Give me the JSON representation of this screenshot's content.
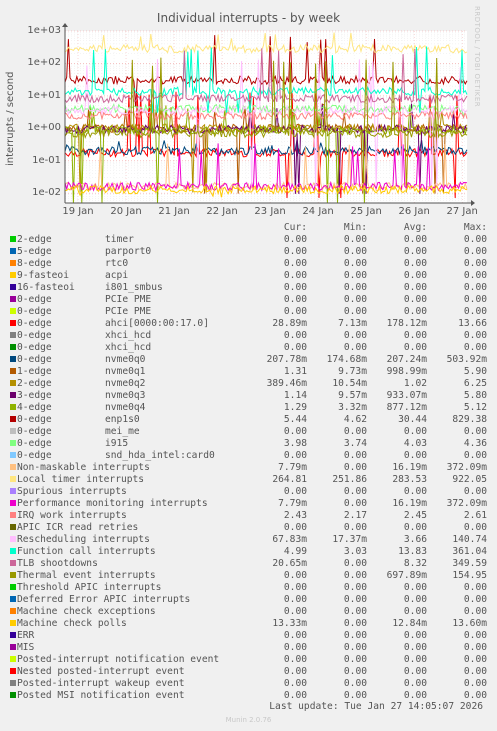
{
  "chart_data": {
    "type": "line",
    "title": "Individual interrupts - by week",
    "ylabel": "interrupts / second",
    "yscale": "log",
    "ylim": [
      0.005,
      1000
    ],
    "yticks": [
      {
        "label": "1e-02",
        "value": 0.01
      },
      {
        "label": "1e-01",
        "value": 0.1
      },
      {
        "label": "1e+00",
        "value": 1
      },
      {
        "label": "1e+01",
        "value": 10
      },
      {
        "label": "1e+02",
        "value": 100
      },
      {
        "label": "1e+03",
        "value": 1000
      }
    ],
    "xticks": [
      "19 Jan",
      "20 Jan",
      "21 Jan",
      "22 Jan",
      "23 Jan",
      "24 Jan",
      "25 Jan",
      "26 Jan",
      "27 Jan"
    ],
    "grid": true,
    "watermark": "RRDTOOL / TOBI OETIKER",
    "columns": [
      "",
      "",
      "Cur:",
      "Min:",
      "Avg:",
      "Max:"
    ],
    "series": [
      {
        "label": "2-edge",
        "desc": "timer",
        "color": "#00cc00",
        "cur": "0.00",
        "min": "0.00",
        "avg": "0.00",
        "max": "0.00"
      },
      {
        "label": "5-edge",
        "desc": "parport0",
        "color": "#0066b3",
        "cur": "0.00",
        "min": "0.00",
        "avg": "0.00",
        "max": "0.00"
      },
      {
        "label": "8-edge",
        "desc": "rtc0",
        "color": "#ff8000",
        "cur": "0.00",
        "min": "0.00",
        "avg": "0.00",
        "max": "0.00"
      },
      {
        "label": "9-fasteoi",
        "desc": "acpi",
        "color": "#ffcc00",
        "cur": "0.00",
        "min": "0.00",
        "avg": "0.00",
        "max": "0.00"
      },
      {
        "label": "16-fasteoi",
        "desc": "i801_smbus",
        "color": "#330099",
        "cur": "0.00",
        "min": "0.00",
        "avg": "0.00",
        "max": "0.00"
      },
      {
        "label": "0-edge",
        "desc": "PCIe PME",
        "color": "#990099",
        "cur": "0.00",
        "min": "0.00",
        "avg": "0.00",
        "max": "0.00"
      },
      {
        "label": "0-edge",
        "desc": "PCIe PME",
        "color": "#ccff00",
        "cur": "0.00",
        "min": "0.00",
        "avg": "0.00",
        "max": "0.00"
      },
      {
        "label": "0-edge",
        "desc": "ahci[0000:00:17.0]",
        "color": "#ff0000",
        "cur": "28.89m",
        "min": "7.13m",
        "avg": "178.12m",
        "max": "13.66"
      },
      {
        "label": "0-edge",
        "desc": "xhci_hcd",
        "color": "#808080",
        "cur": "0.00",
        "min": "0.00",
        "avg": "0.00",
        "max": "0.00"
      },
      {
        "label": "0-edge",
        "desc": "xhci_hcd",
        "color": "#008f00",
        "cur": "0.00",
        "min": "0.00",
        "avg": "0.00",
        "max": "0.00"
      },
      {
        "label": "0-edge",
        "desc": "nvme0q0",
        "color": "#00487d",
        "cur": "207.78m",
        "min": "174.68m",
        "avg": "207.24m",
        "max": "503.92m"
      },
      {
        "label": "1-edge",
        "desc": "nvme0q1",
        "color": "#b35a00",
        "cur": "1.31",
        "min": "9.73m",
        "avg": "998.99m",
        "max": "5.90"
      },
      {
        "label": "2-edge",
        "desc": "nvme0q2",
        "color": "#b38f00",
        "cur": "389.46m",
        "min": "10.54m",
        "avg": "1.02",
        "max": "6.25"
      },
      {
        "label": "3-edge",
        "desc": "nvme0q3",
        "color": "#6b006b",
        "cur": "1.14",
        "min": "9.57m",
        "avg": "933.07m",
        "max": "5.80"
      },
      {
        "label": "4-edge",
        "desc": "nvme0q4",
        "color": "#8fb300",
        "cur": "1.29",
        "min": "3.32m",
        "avg": "877.12m",
        "max": "5.12"
      },
      {
        "label": "0-edge",
        "desc": "enp1s0",
        "color": "#b30000",
        "cur": "5.44",
        "min": "4.62",
        "avg": "30.44",
        "max": "829.38"
      },
      {
        "label": "0-edge",
        "desc": "mei_me",
        "color": "#bebebe",
        "cur": "0.00",
        "min": "0.00",
        "avg": "0.00",
        "max": "0.00"
      },
      {
        "label": "0-edge",
        "desc": "i915",
        "color": "#80ff80",
        "cur": "3.98",
        "min": "3.74",
        "avg": "4.03",
        "max": "4.36"
      },
      {
        "label": "0-edge",
        "desc": "snd_hda_intel:card0",
        "color": "#80c9ff",
        "cur": "0.00",
        "min": "0.00",
        "avg": "0.00",
        "max": "0.00"
      },
      {
        "label": "Non-maskable interrupts",
        "desc": "",
        "color": "#ffc080",
        "cur": "7.79m",
        "min": "0.00",
        "avg": "16.19m",
        "max": "372.09m"
      },
      {
        "label": "Local timer interrupts",
        "desc": "",
        "color": "#ffe680",
        "cur": "264.81",
        "min": "251.86",
        "avg": "283.53",
        "max": "922.05"
      },
      {
        "label": "Spurious interrupts",
        "desc": "",
        "color": "#aa80ff",
        "cur": "0.00",
        "min": "0.00",
        "avg": "0.00",
        "max": "0.00"
      },
      {
        "label": "Performance monitoring interrupts",
        "desc": "",
        "color": "#ee00cc",
        "cur": "7.79m",
        "min": "0.00",
        "avg": "16.19m",
        "max": "372.09m"
      },
      {
        "label": "IRQ work interrupts",
        "desc": "",
        "color": "#ff8080",
        "cur": "2.43",
        "min": "2.17",
        "avg": "2.45",
        "max": "2.61"
      },
      {
        "label": "APIC ICR read retries",
        "desc": "",
        "color": "#666600",
        "cur": "0.00",
        "min": "0.00",
        "avg": "0.00",
        "max": "0.00"
      },
      {
        "label": "Rescheduling interrupts",
        "desc": "",
        "color": "#ffbfff",
        "cur": "67.83m",
        "min": "17.37m",
        "avg": "3.66",
        "max": "140.74"
      },
      {
        "label": "Function call interrupts",
        "desc": "",
        "color": "#00ffcc",
        "cur": "4.99",
        "min": "3.03",
        "avg": "13.83",
        "max": "361.04"
      },
      {
        "label": "TLB shootdowns",
        "desc": "",
        "color": "#cc6699",
        "cur": "20.65m",
        "min": "0.00",
        "avg": "8.32",
        "max": "349.59"
      },
      {
        "label": "Thermal event interrupts",
        "desc": "",
        "color": "#999900",
        "cur": "0.00",
        "min": "0.00",
        "avg": "697.89m",
        "max": "154.95"
      },
      {
        "label": "Threshold APIC interrupts",
        "desc": "",
        "color": "#00cc00",
        "cur": "0.00",
        "min": "0.00",
        "avg": "0.00",
        "max": "0.00"
      },
      {
        "label": "Deferred Error APIC interrupts",
        "desc": "",
        "color": "#0066b3",
        "cur": "0.00",
        "min": "0.00",
        "avg": "0.00",
        "max": "0.00"
      },
      {
        "label": "Machine check exceptions",
        "desc": "",
        "color": "#ff8000",
        "cur": "0.00",
        "min": "0.00",
        "avg": "0.00",
        "max": "0.00"
      },
      {
        "label": "Machine check polls",
        "desc": "",
        "color": "#ffcc00",
        "cur": "13.33m",
        "min": "0.00",
        "avg": "12.84m",
        "max": "13.60m"
      },
      {
        "label": "ERR",
        "desc": "",
        "color": "#330099",
        "cur": "0.00",
        "min": "0.00",
        "avg": "0.00",
        "max": "0.00"
      },
      {
        "label": "MIS",
        "desc": "",
        "color": "#990099",
        "cur": "0.00",
        "min": "0.00",
        "avg": "0.00",
        "max": "0.00"
      },
      {
        "label": "Posted-interrupt notification event",
        "desc": "",
        "color": "#ccff00",
        "cur": "0.00",
        "min": "0.00",
        "avg": "0.00",
        "max": "0.00"
      },
      {
        "label": "Nested posted-interrupt event",
        "desc": "",
        "color": "#ff0000",
        "cur": "0.00",
        "min": "0.00",
        "avg": "0.00",
        "max": "0.00"
      },
      {
        "label": "Posted-interrupt wakeup event",
        "desc": "",
        "color": "#808080",
        "cur": "0.00",
        "min": "0.00",
        "avg": "0.00",
        "max": "0.00"
      },
      {
        "label": "Posted MSI notification event",
        "desc": "",
        "color": "#008f00",
        "cur": "0.00",
        "min": "0.00",
        "avg": "0.00",
        "max": "0.00"
      }
    ],
    "last_update": "Last update: Tue Jan 27 14:05:07 2026",
    "version": "Munin 2.0.76"
  }
}
